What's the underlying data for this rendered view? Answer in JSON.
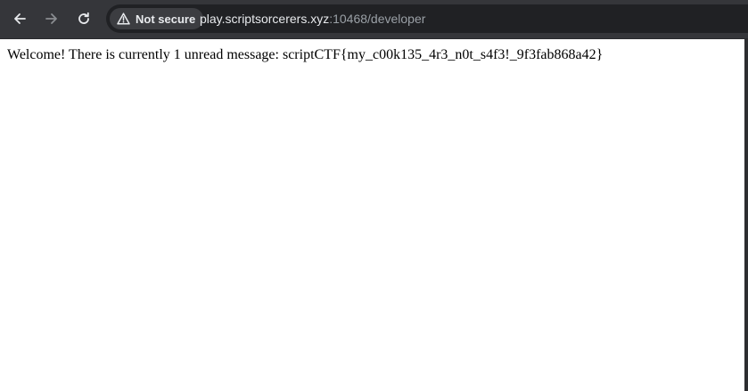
{
  "browser": {
    "security_label": "Not secure",
    "url_host": "play.scriptsorcerers.xyz",
    "url_rest": ":10468/developer",
    "icons": {
      "back": "arrow-left-icon",
      "forward": "arrow-right-icon",
      "reload": "reload-icon",
      "security": "warning-triangle-icon"
    },
    "colors": {
      "toolbar": "#35363a",
      "omnibox": "#202124",
      "chip": "#3c3d41",
      "text_primary": "#e8eaed",
      "text_secondary": "#9aa0a6"
    }
  },
  "page": {
    "message": "Welcome! There is currently 1 unread message: scriptCTF{my_c00k135_4r3_n0t_s4f3!_9f3fab868a42}",
    "background": "#ffffff"
  }
}
